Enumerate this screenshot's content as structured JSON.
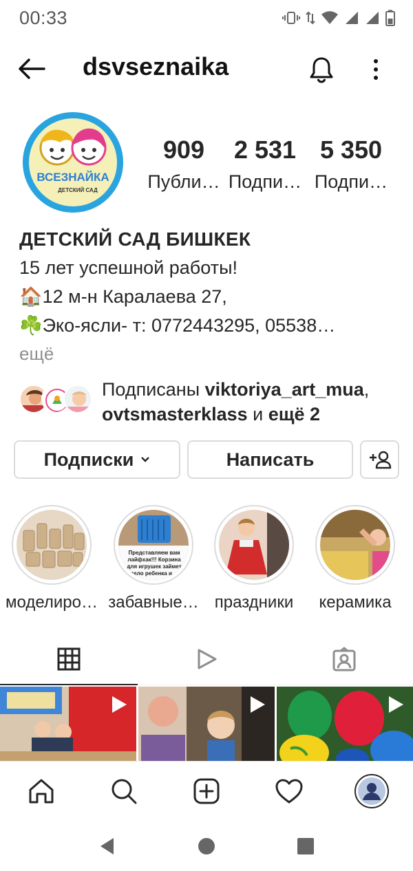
{
  "status_bar": {
    "time": "00:33"
  },
  "header": {
    "username": "dsvseznaika"
  },
  "profile": {
    "avatar_text": "ВСЕЗНАЙКА",
    "avatar_subtext": "ДЕТСКИЙ САД",
    "stats": [
      {
        "value": "909",
        "label": "Публи…"
      },
      {
        "value": "2 531",
        "label": "Подпи…"
      },
      {
        "value": "5 350",
        "label": "Подпи…"
      }
    ]
  },
  "bio": {
    "name": "ДЕТСКИЙ САД БИШКЕК",
    "line1": "15 лет успешной работы!",
    "line2_emoji": "🏠",
    "line2": "12 м-н Каралаева 27,",
    "line3_emoji": "☘️",
    "line3": "Эко-ясли- т: 0772443295, 05538…",
    "more": "ещё"
  },
  "followed_by": {
    "prefix": "Подписаны ",
    "user1": "viktoriya_art_mua",
    "comma": ",",
    "user2": "ovtsmasterklass",
    "joiner": " и ",
    "more": "ещё 2"
  },
  "actions": {
    "following_label": "Подписки",
    "message_label": "Написать"
  },
  "highlights": [
    {
      "label": "моделиро…"
    },
    {
      "label": "забавные…",
      "caption": "Представляем вам лайфхак!!! Корзина для игрушек займет дело ребенка и ..."
    },
    {
      "label": "праздники"
    },
    {
      "label": "керамика"
    }
  ],
  "tabs": [
    "grid-icon",
    "reels-icon",
    "tagged-icon"
  ],
  "bottom_nav": [
    "home-icon",
    "search-icon",
    "new-post-icon",
    "activity-icon",
    "profile-avatar"
  ],
  "colors": {
    "text": "#262626",
    "secondary": "#8e8e8e",
    "border": "#dbdbdb",
    "avatar_bg": "#29a4df"
  }
}
